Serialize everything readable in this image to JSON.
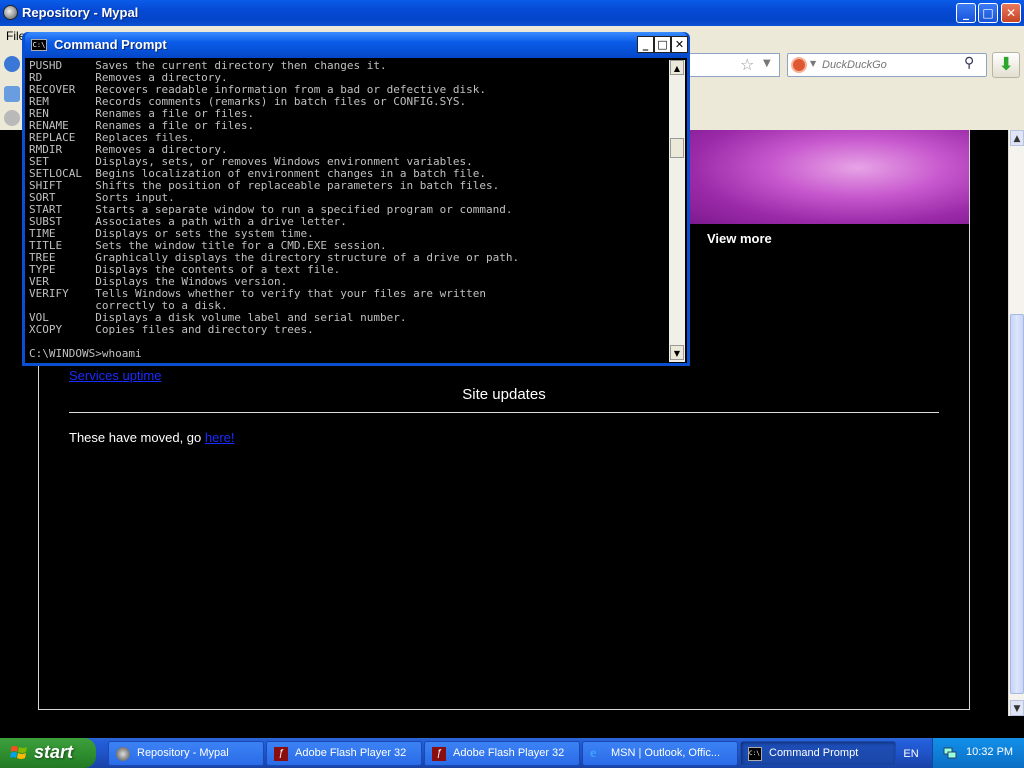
{
  "browser": {
    "title": "Repository - Mypal",
    "menu_file": "File",
    "search_placeholder": "DuckDuckGo",
    "buttons": {
      "minimize": "_",
      "maximize": "□",
      "close": "✕"
    }
  },
  "page": {
    "view_more": "View more",
    "services_link": "Services uptime",
    "site_updates": "Site updates",
    "moved_text": "These have moved, go ",
    "moved_link": "here!"
  },
  "cmd": {
    "title": "Command Prompt",
    "icon_text": "C:\\",
    "buttons": {
      "minimize": "_",
      "maximize": "□",
      "close": "✕"
    },
    "lines": [
      "PUSHD     Saves the current directory then changes it.",
      "RD        Removes a directory.",
      "RECOVER   Recovers readable information from a bad or defective disk.",
      "REM       Records comments (remarks) in batch files or CONFIG.SYS.",
      "REN       Renames a file or files.",
      "RENAME    Renames a file or files.",
      "REPLACE   Replaces files.",
      "RMDIR     Removes a directory.",
      "SET       Displays, sets, or removes Windows environment variables.",
      "SETLOCAL  Begins localization of environment changes in a batch file.",
      "SHIFT     Shifts the position of replaceable parameters in batch files.",
      "SORT      Sorts input.",
      "START     Starts a separate window to run a specified program or command.",
      "SUBST     Associates a path with a drive letter.",
      "TIME      Displays or sets the system time.",
      "TITLE     Sets the window title for a CMD.EXE session.",
      "TREE      Graphically displays the directory structure of a drive or path.",
      "TYPE      Displays the contents of a text file.",
      "VER       Displays the Windows version.",
      "VERIFY    Tells Windows whether to verify that your files are written",
      "          correctly to a disk.",
      "VOL       Displays a disk volume label and serial number.",
      "XCOPY     Copies files and directory trees.",
      "",
      "C:\\WINDOWS>whoami"
    ]
  },
  "taskbar": {
    "start_label": "start",
    "items": [
      {
        "label": "Repository - Mypal",
        "icon": "mypal-icon",
        "active": false
      },
      {
        "label": "Adobe Flash Player 32",
        "icon": "flash-icon",
        "active": false
      },
      {
        "label": "Adobe Flash Player 32",
        "icon": "flash-icon",
        "active": false
      },
      {
        "label": "MSN | Outlook, Offic...",
        "icon": "ie-icon",
        "active": false
      },
      {
        "label": "Command Prompt",
        "icon": "cmd-icon",
        "active": true
      }
    ],
    "language": "EN",
    "clock": "10:32 PM"
  }
}
